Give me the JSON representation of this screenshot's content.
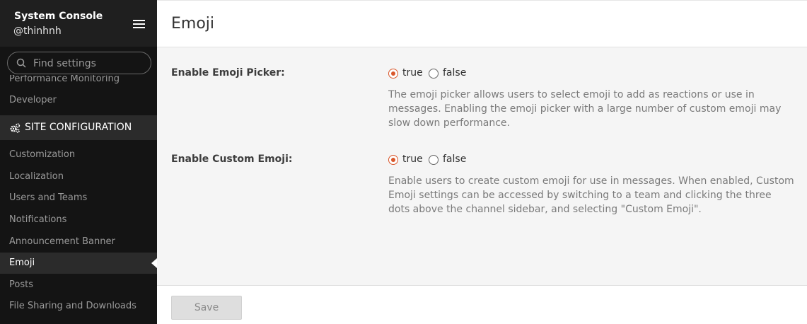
{
  "sidebar": {
    "title": "System Console",
    "username": "@thinhnh",
    "search_placeholder": "Find settings",
    "partial_item": "Performance Monitoring",
    "developer": "Developer",
    "section_title": "SITE CONFIGURATION",
    "items": [
      "Customization",
      "Localization",
      "Users and Teams",
      "Notifications",
      "Announcement Banner",
      "Emoji",
      "Posts",
      "File Sharing and Downloads"
    ],
    "active_item": "Emoji"
  },
  "page": {
    "title": "Emoji"
  },
  "settings": {
    "emoji_picker": {
      "label": "Enable Emoji Picker:",
      "true_label": "true",
      "false_label": "false",
      "selected": "true",
      "help": "The emoji picker allows users to select emoji to add as reactions or use in messages. Enabling the emoji picker with a large number of custom emoji may slow down performance."
    },
    "custom_emoji": {
      "label": "Enable Custom Emoji:",
      "true_label": "true",
      "false_label": "false",
      "selected": "true",
      "help": "Enable users to create custom emoji for use in messages. When enabled, Custom Emoji settings can be accessed by switching to a team and clicking the three dots above the channel sidebar, and selecting \"Custom Emoji\"."
    }
  },
  "footer": {
    "save_label": "Save"
  },
  "colors": {
    "accent": "#d9572b",
    "sidebar_bg": "#141414"
  }
}
